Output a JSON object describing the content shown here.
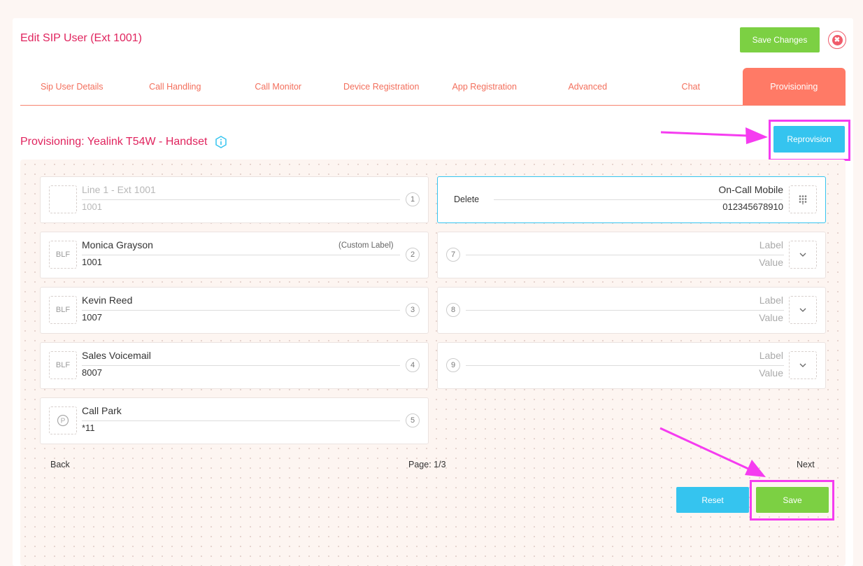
{
  "header": {
    "title": "Edit SIP User (Ext 1001)",
    "save_changes": "Save Changes",
    "close_glyph": "✖"
  },
  "tabs": [
    {
      "label": "Sip User Details"
    },
    {
      "label": "Call Handling"
    },
    {
      "label": "Call Monitor"
    },
    {
      "label": "Device Registration"
    },
    {
      "label": "App Registration"
    },
    {
      "label": "Advanced"
    },
    {
      "label": "Chat"
    },
    {
      "label": "Provisioning",
      "active": true
    }
  ],
  "provisioning": {
    "title": "Provisioning: Yealink T54W - Handset",
    "reprovision": "Reprovision"
  },
  "left_keys": [
    {
      "type": "",
      "label": "Line 1 - Ext 1001",
      "value": "1001",
      "number": "1"
    },
    {
      "type": "BLF",
      "label": "Monica Grayson",
      "custom_label": "(Custom Label)",
      "value": "1001",
      "number": "2"
    },
    {
      "type": "BLF",
      "label": "Kevin Reed",
      "value": "1007",
      "number": "3"
    },
    {
      "type": "BLF",
      "label": "Sales Voicemail",
      "value": "8007",
      "number": "4"
    },
    {
      "type": "park-icon",
      "label": "Call Park",
      "value": "*11",
      "number": "5"
    }
  ],
  "selected_key": {
    "delete": "Delete",
    "label": "On-Call Mobile",
    "value": "012345678910"
  },
  "right_keys": [
    {
      "number": "7",
      "label": "Label",
      "value": "Value"
    },
    {
      "number": "8",
      "label": "Label",
      "value": "Value"
    },
    {
      "number": "9",
      "label": "Label",
      "value": "Value"
    }
  ],
  "pager": {
    "back": "Back",
    "page": "Page: 1/3",
    "next": "Next"
  },
  "actions": {
    "reset": "Reset",
    "save": "Save"
  },
  "colors": {
    "accent": "#e0245e",
    "tab": "#ff7a66",
    "green": "#7cd043",
    "blue": "#35c4ef",
    "highlight": "#f53cf0"
  }
}
